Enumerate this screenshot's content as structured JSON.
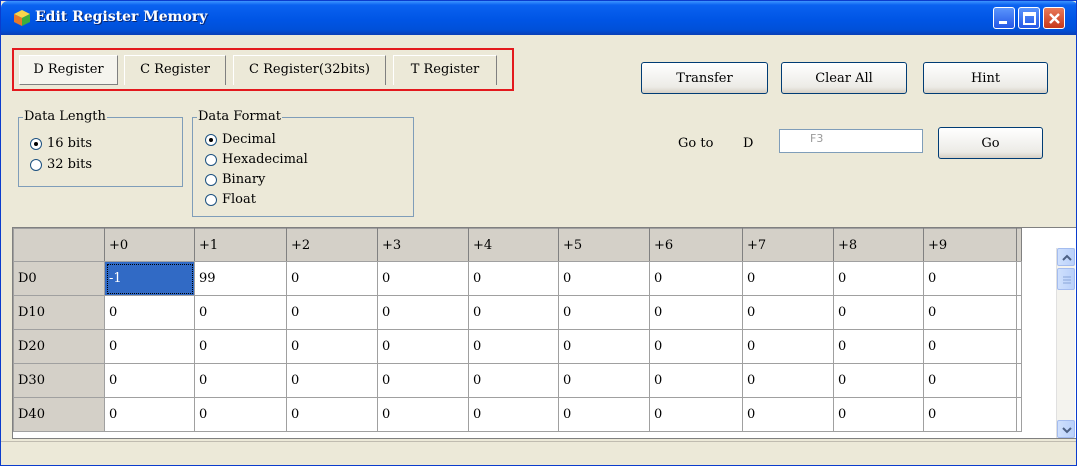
{
  "window": {
    "title": "Edit Register Memory"
  },
  "tabs": [
    {
      "label": "D Register",
      "active": true
    },
    {
      "label": "C Register",
      "active": false
    },
    {
      "label": "C Register(32bits)",
      "active": false
    },
    {
      "label": "T Register",
      "active": false
    }
  ],
  "toolbar": {
    "transfer": "Transfer",
    "clear_all": "Clear All",
    "hint": "Hint"
  },
  "data_length": {
    "legend": "Data Length",
    "options": [
      "16 bits",
      "32 bits"
    ],
    "selected": "16 bits"
  },
  "data_format": {
    "legend": "Data Format",
    "options": [
      "Decimal",
      "Hexadecimal",
      "Binary",
      "Float"
    ],
    "selected": "Decimal"
  },
  "goto": {
    "label": "Go to",
    "prefix": "D",
    "placeholder": "F3",
    "button": "Go"
  },
  "grid": {
    "columns": [
      "+0",
      "+1",
      "+2",
      "+3",
      "+4",
      "+5",
      "+6",
      "+7",
      "+8",
      "+9"
    ],
    "rows": [
      {
        "label": "D0",
        "values": [
          "-1",
          "99",
          "0",
          "0",
          "0",
          "0",
          "0",
          "0",
          "0",
          "0"
        ]
      },
      {
        "label": "D10",
        "values": [
          "0",
          "0",
          "0",
          "0",
          "0",
          "0",
          "0",
          "0",
          "0",
          "0"
        ]
      },
      {
        "label": "D20",
        "values": [
          "0",
          "0",
          "0",
          "0",
          "0",
          "0",
          "0",
          "0",
          "0",
          "0"
        ]
      },
      {
        "label": "D30",
        "values": [
          "0",
          "0",
          "0",
          "0",
          "0",
          "0",
          "0",
          "0",
          "0",
          "0"
        ]
      },
      {
        "label": "D40",
        "values": [
          "0",
          "0",
          "0",
          "0",
          "0",
          "0",
          "0",
          "0",
          "0",
          "0"
        ]
      }
    ],
    "selected_cell": "D0 +0"
  },
  "colors": {
    "titlebar": "#0055e5",
    "highlight_outline": "#e3191d",
    "selection": "#316ac5"
  }
}
